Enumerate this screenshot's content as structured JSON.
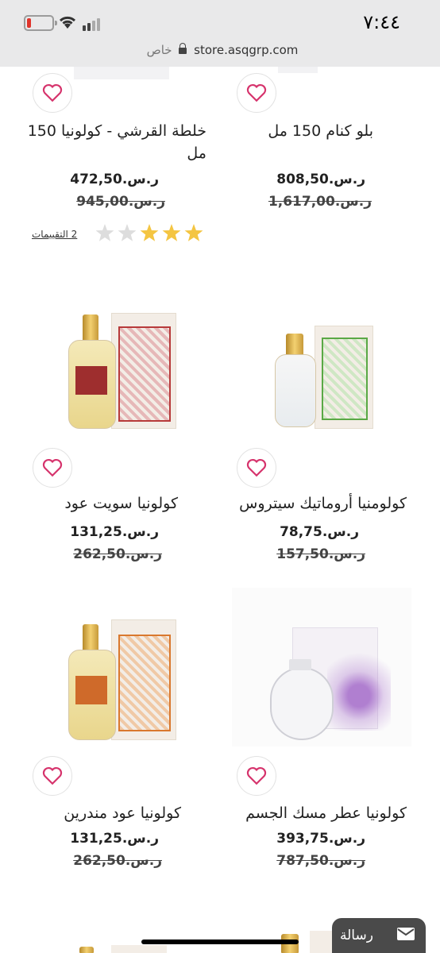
{
  "status": {
    "time": "٧:٤٤"
  },
  "browser": {
    "url": "store.asqgrp.com",
    "private_label": "خاص"
  },
  "products": [
    {
      "name": "بلو كنام 150 مل",
      "price": "808,50.ر.س",
      "old_price": "1,617,00.ر.س"
    },
    {
      "name": "خلطة القرشي - كولونيا 150 مل",
      "price": "472,50.ر.س",
      "old_price": "945,00.ر.س",
      "rating": 3,
      "rating_max": 5,
      "ratings_label": "2 التقييمات"
    },
    {
      "name": "كولومنيا أروماتيك سيتروس",
      "price": "78,75.ر.س",
      "old_price": "157,50.ر.س"
    },
    {
      "name": "كولونيا سويت عود",
      "price": "131,25.ر.س",
      "old_price": "262,50.ر.س"
    },
    {
      "name": "كولونيا عطر مسك الجسم",
      "price": "393,75.ر.س",
      "old_price": "787,50.ر.س"
    },
    {
      "name": "كولونيا عود مندرين",
      "price": "131,25.ر.س",
      "old_price": "262,50.ر.س"
    }
  ],
  "chat": {
    "label": "رسالة"
  },
  "colors": {
    "heart": "#d6336c",
    "star": "#f4c542",
    "star_empty": "#dddddd"
  }
}
